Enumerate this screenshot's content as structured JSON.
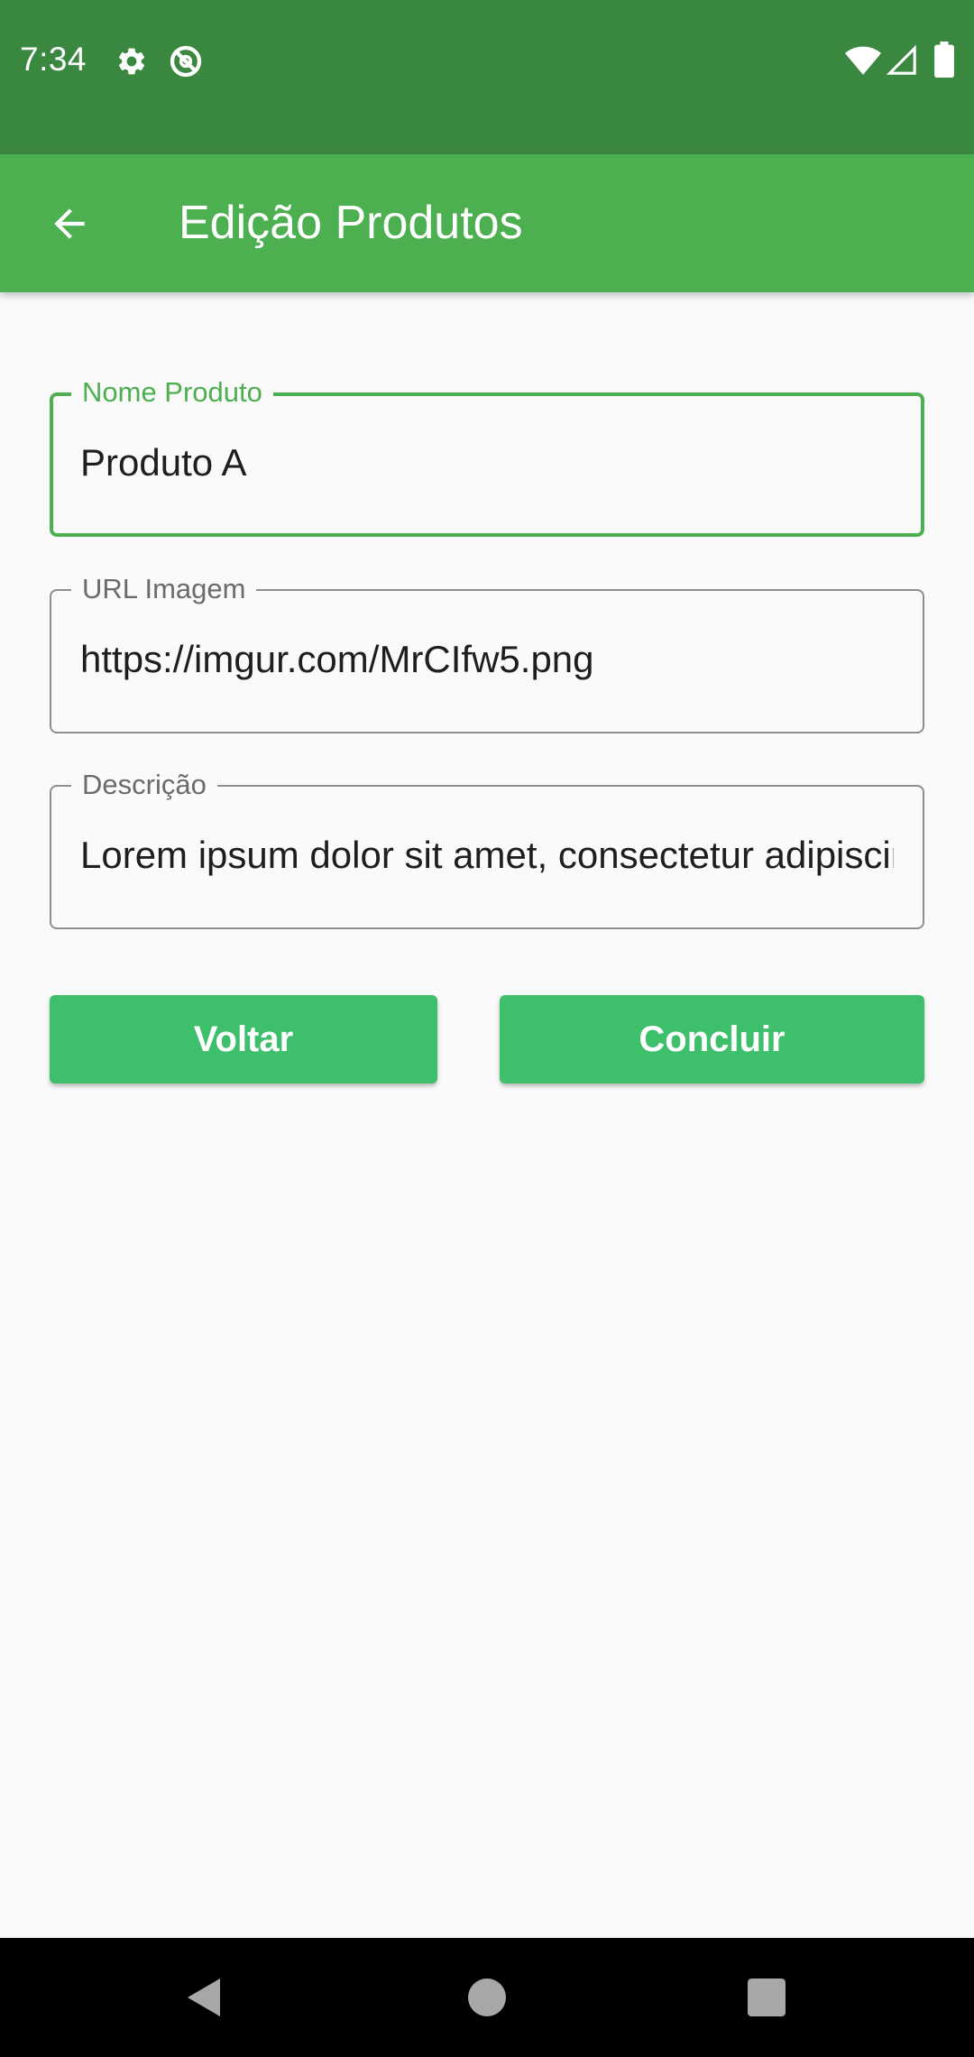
{
  "status_bar": {
    "time": "7:34",
    "icons": [
      "settings-gear",
      "do-not-disturb",
      "wifi",
      "cell-signal",
      "battery"
    ]
  },
  "app_bar": {
    "back_icon": "arrow-left",
    "title": "Edição Produtos"
  },
  "form": {
    "nome_produto": {
      "label": "Nome Produto",
      "value": "Produto A",
      "focused": true
    },
    "url_imagem": {
      "label": "URL Imagem",
      "value": "https://imgur.com/MrCIfw5.png"
    },
    "descricao": {
      "label": "Descrição",
      "value": "Lorem ipsum dolor sit amet, consectetur adipiscing elit"
    }
  },
  "buttons": {
    "voltar": "Voltar",
    "concluir": "Concluir"
  },
  "nav_bar": {
    "icons": [
      "back-triangle",
      "home-circle",
      "recents-square"
    ]
  },
  "colors": {
    "status_bar": "#3a873f",
    "app_bar": "#4caf50",
    "button": "#3dbf6b",
    "background": "#fafafa",
    "focused_border": "#4caf50",
    "idle_border": "#8e8e8e"
  }
}
